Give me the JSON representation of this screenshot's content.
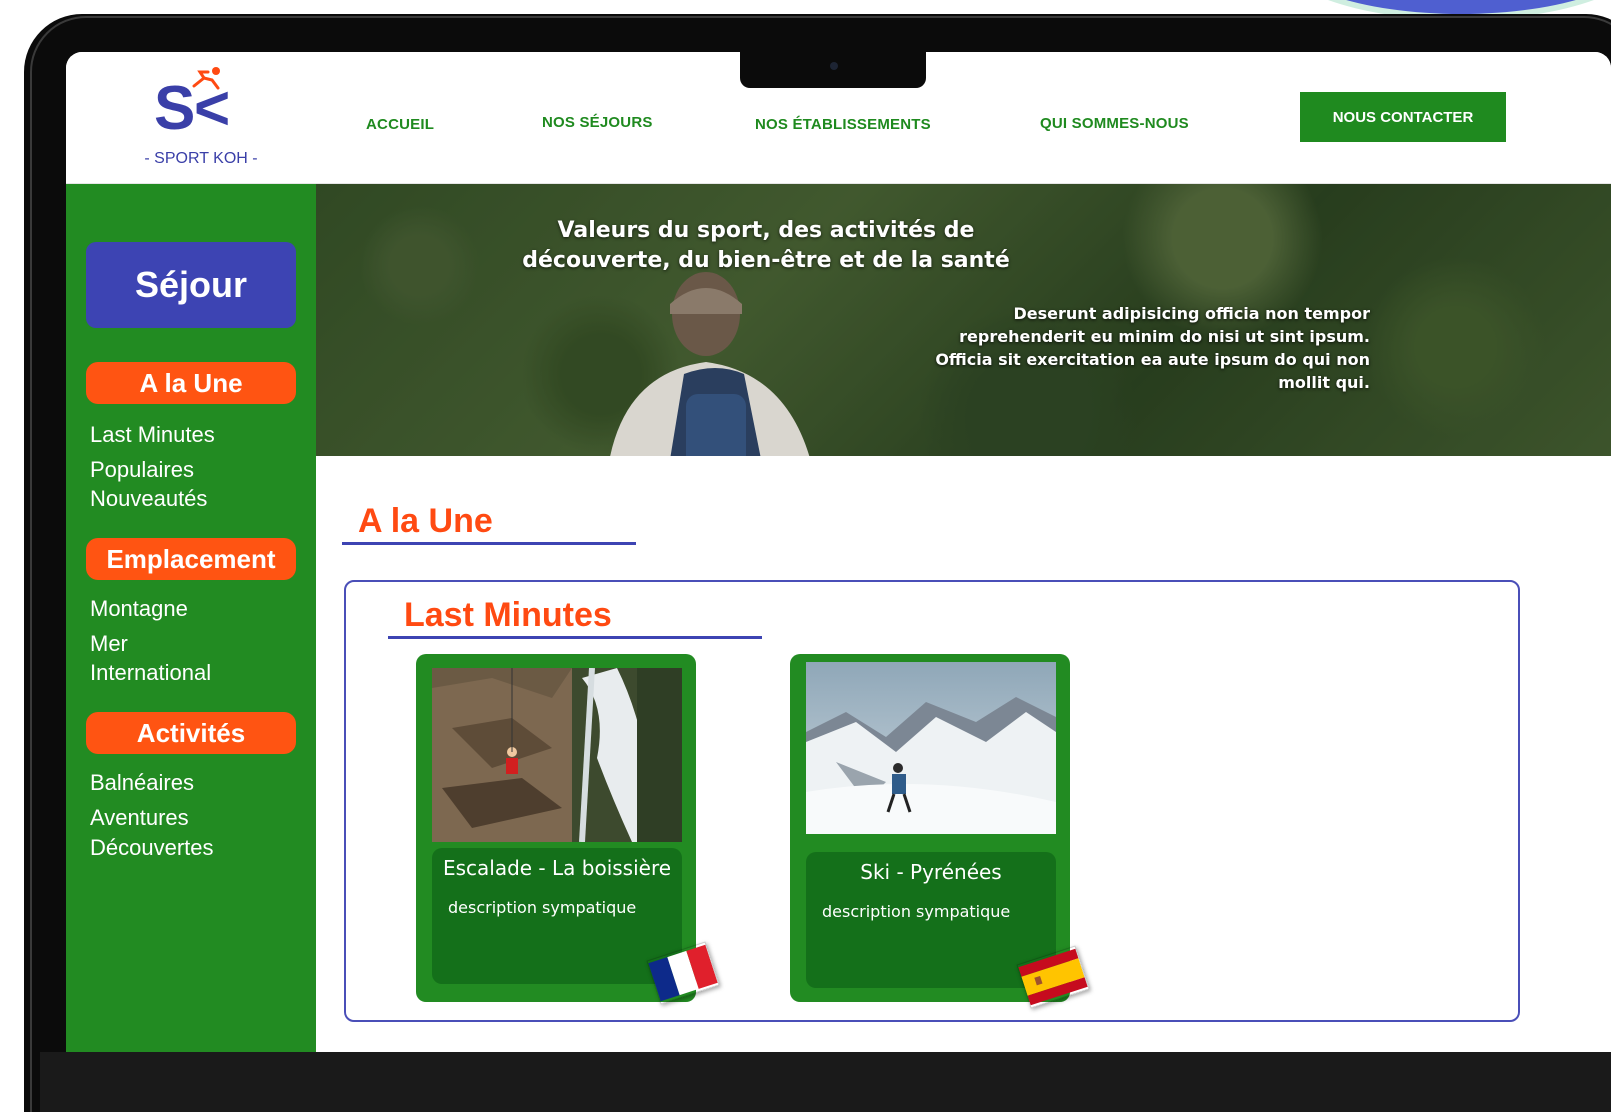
{
  "brand": {
    "logo_tagline": "- SPORT KOH -",
    "colors": {
      "green": "#228b22",
      "blue": "#3d44b3",
      "orange": "#ff4a12"
    }
  },
  "nav": {
    "items": [
      "ACCUEIL",
      "NOS SÉJOURS",
      "NOS ÉTABLISSEMENTS",
      "QUI SOMMES-NOUS"
    ],
    "contact_label": "NOUS CONTACTER"
  },
  "sidebar": {
    "title": "Séjour",
    "groups": [
      {
        "label": "A la Une",
        "links": [
          "Last Minutes",
          "Populaires",
          "Nouveautés"
        ]
      },
      {
        "label": "Emplacement",
        "links": [
          "Montagne",
          "Mer",
          "International"
        ]
      },
      {
        "label": "Activités",
        "links": [
          "Balnéaires",
          "Aventures",
          "Découvertes"
        ]
      }
    ]
  },
  "hero": {
    "title": "Valeurs du sport, des activités de découverte, du bien-être et de la santé",
    "description": "Deserunt adipisicing officia non tempor reprehenderit eu minim do nisi ut sint ipsum. Officia sit exercitation ea aute ipsum do qui non mollit qui."
  },
  "main": {
    "section_title": "A la Une",
    "subsection_title": "Last Minutes",
    "cards": [
      {
        "title": "Escalade - La boissière",
        "description": "description sympatique",
        "flag": "france-flag-icon"
      },
      {
        "title": "Ski - Pyrénées",
        "description": "description sympatique",
        "flag": "spain-flag-icon"
      }
    ]
  }
}
